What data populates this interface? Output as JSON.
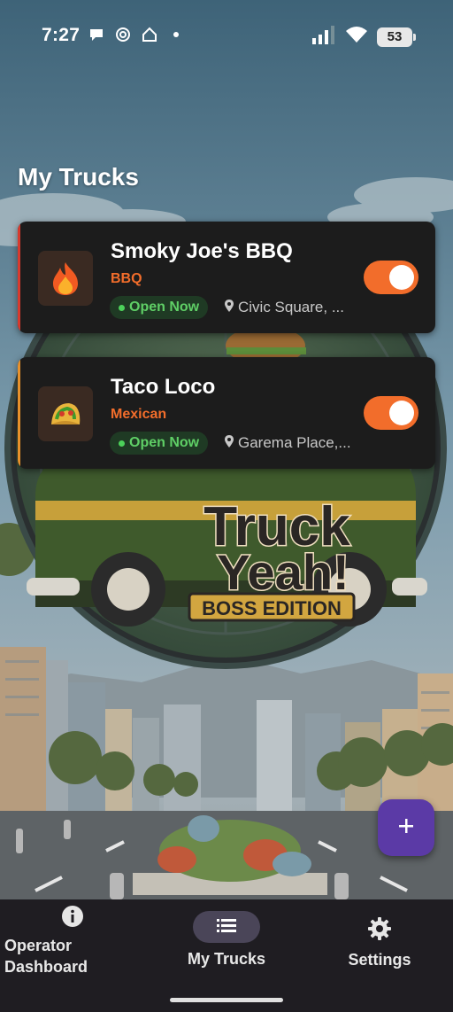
{
  "status_bar": {
    "time": "7:27",
    "battery": "53"
  },
  "header": {
    "title": "My Trucks"
  },
  "logo": {
    "line1": "Truck",
    "line2": "Yeah!",
    "edition": "BOSS EDITION"
  },
  "trucks": [
    {
      "name": "Smoky Joe's BBQ",
      "cuisine": "BBQ",
      "status": "Open Now",
      "location": "Civic Square, ...",
      "icon": "fire-icon",
      "accent": "#d83a2e",
      "active": true
    },
    {
      "name": "Taco Loco",
      "cuisine": "Mexican",
      "status": "Open Now",
      "location": "Garema Place,...",
      "icon": "taco-icon",
      "accent": "#e8912b",
      "active": true
    }
  ],
  "fab": {
    "icon": "plus-icon"
  },
  "nav": {
    "operator_line1": "Operator",
    "operator_line2": "Dashboard",
    "my_trucks": "My Trucks",
    "settings": "Settings",
    "selected": "My Trucks"
  },
  "colors": {
    "accent_orange": "#f26d2b",
    "open_green": "#5fcf66",
    "fab_purple": "#5b3aa6",
    "card_bg": "#1c1c1c"
  }
}
